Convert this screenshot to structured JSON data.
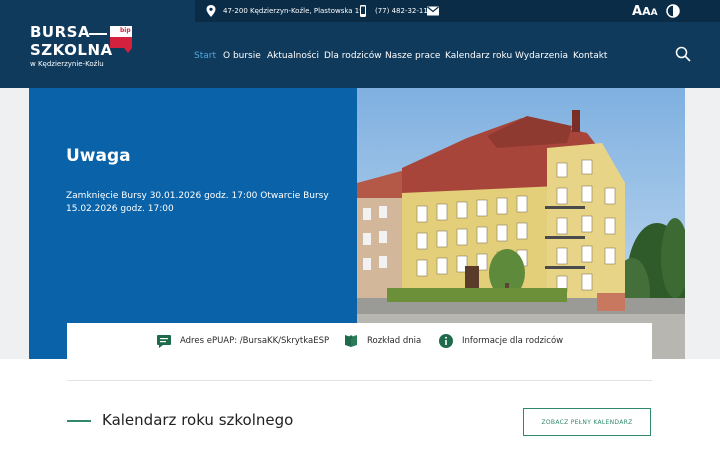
{
  "logo": {
    "line1": "BURSA",
    "line2": "SZKOLNA",
    "subtitle": "w Kędzierzynie-Koźlu",
    "bip_label": "bip"
  },
  "topbar": {
    "address": "47-200 Kędzierzyn-Koźle, Plastowska 19",
    "phone": "(77) 482-32-11",
    "font_size_label": "AAA",
    "icons": [
      "location-pin-icon",
      "phone-icon",
      "envelope-icon",
      "text-size-icon",
      "contrast-icon"
    ]
  },
  "nav": {
    "items": [
      {
        "label": "Start",
        "active": true
      },
      {
        "label": "O bursie",
        "active": false
      },
      {
        "label": "Aktualności",
        "active": false
      },
      {
        "label": "Dla rodziców",
        "active": false
      },
      {
        "label": "Nasze prace",
        "active": false
      },
      {
        "label": "Kalendarz roku",
        "active": false
      },
      {
        "label": "Wydarzenia",
        "active": false
      },
      {
        "label": "Kontakt",
        "active": false
      }
    ],
    "search_icon": "search-icon"
  },
  "hero": {
    "title": "Uwaga",
    "text": "Zamknięcie Bursy 30.01.2026 godz. 17:00 Otwarcie Bursy 15.02.2026 godz. 17:00"
  },
  "info": {
    "items": [
      {
        "label": "Adres ePUAP: /BursaKK/SkrytkaESP",
        "icon": "chat-icon"
      },
      {
        "label": "Rozkład dnia",
        "icon": "book-icon"
      },
      {
        "label": "Informacje dla rodziców",
        "icon": "info-icon"
      }
    ]
  },
  "calendar": {
    "title": "Kalendarz roku szkolnego",
    "button": "ZOBACZ PEŁNY KALENDARZ"
  },
  "colors": {
    "header_bg": "#0f3a5c",
    "topbar_bg": "#0a2c47",
    "hero_blue": "#0a62a8",
    "accent_green": "#2f8a6a",
    "nav_active": "#4fa8e0"
  }
}
